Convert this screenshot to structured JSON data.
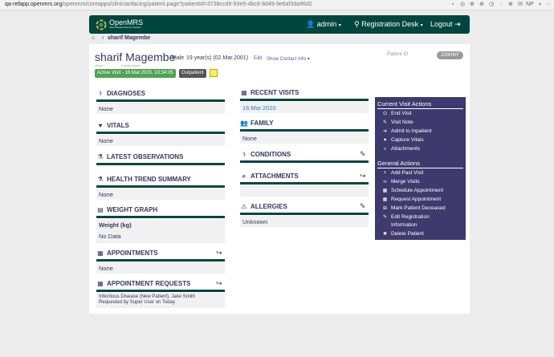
{
  "browser": {
    "url_host": "qa-refapp.openmrs.org",
    "url_path": "/openmrs/coreapps/clinicianfacing/patient.page?patientId=3738ccd9-93e5-4bc8-8d49-9e6af3da96d2",
    "extensions": [
      "⋆",
      "◎",
      "⊕",
      "⊕",
      "◷",
      "◌",
      "⊗",
      "✉",
      "⊙",
      "◐",
      "NP",
      "◑",
      "⋯"
    ]
  },
  "header": {
    "logo_text": "OpenMRS",
    "logo_sub": "Open Medical Record System",
    "user": "admin",
    "location": "Registration Desk",
    "logout": "Logout"
  },
  "breadcrumb": {
    "home_icon": "home-icon",
    "sep": "›",
    "patient": "sharif Magembe"
  },
  "patient": {
    "given": "sharif",
    "family": "Magembe",
    "given_label": "Given",
    "family_label": "Family Name",
    "gender": "Male",
    "age": "19 year(s) (02.Mar.2001)",
    "edit": "Edit",
    "show_contact": "Show Contact Info ▾",
    "id_label": "Patient ID",
    "id": "100HNY",
    "visit_tag": "Active Visit - 16.Mar.2020, 10:34:05",
    "type_tag": "Outpatient"
  },
  "left_cards": {
    "diagnoses": {
      "title": "DIAGNOSES",
      "body": "None"
    },
    "vitals": {
      "title": "VITALS",
      "body": "None"
    },
    "observations": {
      "title": "LATEST OBSERVATIONS"
    },
    "health_trend": {
      "title": "HEALTH TREND SUMMARY",
      "body": "None"
    },
    "weight_graph": {
      "title": "WEIGHT GRAPH",
      "label": "Weight (kg)",
      "body": "No Data"
    },
    "appointments": {
      "title": "APPOINTMENTS",
      "body": "None"
    },
    "appt_requests": {
      "title": "APPOINTMENT REQUESTS",
      "line1": "Infectious Disease (New Patient), Jake Smith",
      "line2": "Requested by Super User on Today"
    }
  },
  "mid_cards": {
    "recent_visits": {
      "title": "RECENT VISITS",
      "body": "16.Mar.2020"
    },
    "family": {
      "title": "FAMILY",
      "body": "None"
    },
    "conditions": {
      "title": "CONDITIONS"
    },
    "attachments": {
      "title": "ATTACHMENTS"
    },
    "allergies": {
      "title": "ALLERGIES",
      "body": "Unknown"
    }
  },
  "sidebar": {
    "current_title": "Current Visit Actions",
    "current_items": [
      {
        "icon": "end-visit-icon",
        "glyph": "⏻",
        "label": "End Visit"
      },
      {
        "icon": "visit-note-icon",
        "glyph": "✎",
        "label": "Visit Note"
      },
      {
        "icon": "admit-icon",
        "glyph": "➜",
        "label": "Admit to Inpatient"
      },
      {
        "icon": "vitals-icon",
        "glyph": "♥",
        "label": "Capture Vitals"
      },
      {
        "icon": "paperclip-icon",
        "glyph": "⌕",
        "label": "Attachments"
      }
    ],
    "general_title": "General Actions",
    "general_items": [
      {
        "icon": "plus-icon",
        "glyph": "+",
        "label": "Add Past Visit"
      },
      {
        "icon": "link-icon",
        "glyph": "∞",
        "label": "Merge Visits"
      },
      {
        "icon": "calendar-icon",
        "glyph": "▦",
        "label": "Schedule Appointment"
      },
      {
        "icon": "calendar-icon",
        "glyph": "▦",
        "label": "Request Appointment"
      },
      {
        "icon": "deceased-icon",
        "glyph": "⊞",
        "label": "Mark Patient Deceased"
      },
      {
        "icon": "pencil-icon",
        "glyph": "✎",
        "label": "Edit Registration"
      },
      {
        "icon": "delete-icon",
        "glyph": "✖",
        "label": "Delete Patient"
      }
    ],
    "edit_reg_line2": "Information"
  },
  "colors": {
    "brand": "#00463f",
    "sidebar": "#3e3a6e",
    "text": "#363463",
    "link": "#5b57a6"
  }
}
